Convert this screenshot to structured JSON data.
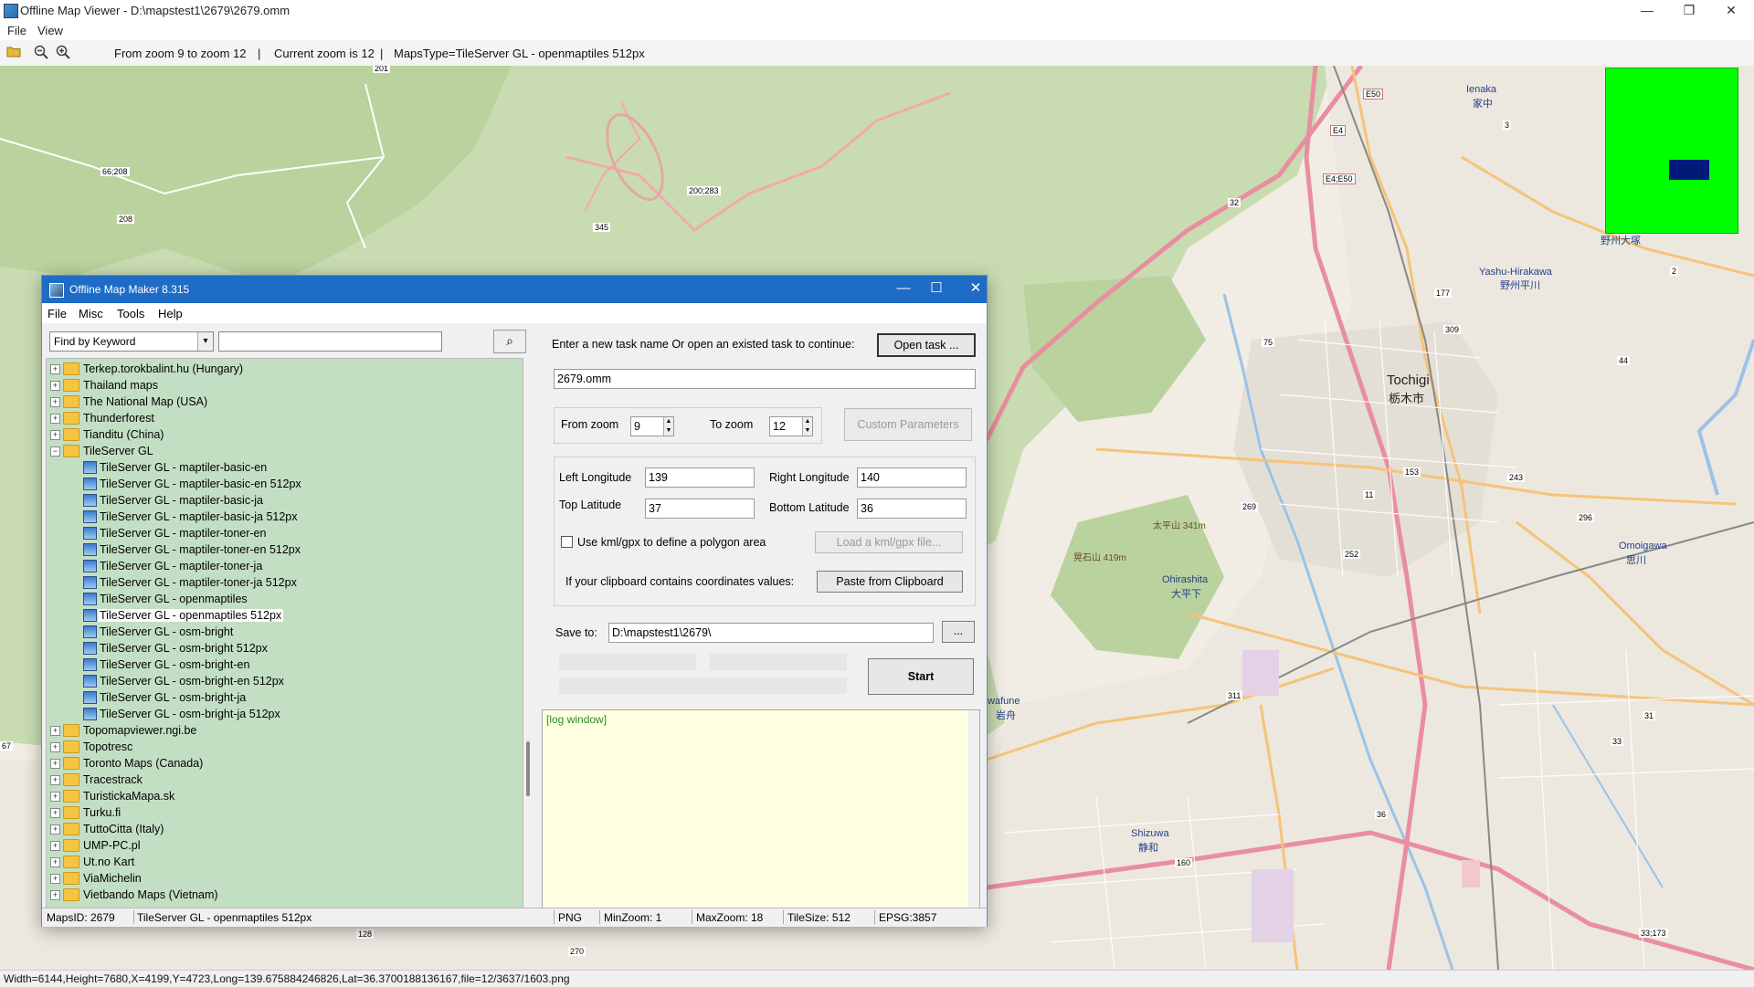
{
  "window": {
    "title": "Offline Map Viewer - D:\\mapstest1\\2679\\2679.omm",
    "minimize": "—",
    "maximize": "❐",
    "close": "✕"
  },
  "menu": {
    "file": "File",
    "view": "View"
  },
  "toolbar": {
    "zoom_range": "From zoom 9 to zoom 12",
    "current_zoom": "Current zoom is 12",
    "maps_type": "MapsType=TileServer GL - openmaptiles 512px",
    "sep": "|"
  },
  "map_labels": [
    {
      "text": "Ienaka"
    },
    {
      "text": "家中"
    },
    {
      "text": "E50"
    },
    {
      "text": "E4"
    },
    {
      "text": "E4;E50"
    },
    {
      "text": "Tochigi"
    },
    {
      "text": "栃木市"
    },
    {
      "text": "Yashu-Hirakawa"
    },
    {
      "text": "野州平川"
    },
    {
      "text": "Ohirashita"
    },
    {
      "text": "大平下"
    },
    {
      "text": "Omoigawa"
    },
    {
      "text": "思川"
    },
    {
      "text": "Iwafune"
    },
    {
      "text": "岩舟"
    },
    {
      "text": "Shizuwa"
    },
    {
      "text": "静和"
    },
    {
      "text": "野州大塚"
    },
    {
      "text": "太平山 341m"
    },
    {
      "text": "晃石山 419m"
    },
    {
      "text": "201"
    },
    {
      "text": "66;208"
    },
    {
      "text": "208"
    },
    {
      "text": "200;283"
    },
    {
      "text": "345"
    },
    {
      "text": "32"
    },
    {
      "text": "309"
    },
    {
      "text": "177"
    },
    {
      "text": "75"
    },
    {
      "text": "44"
    },
    {
      "text": "153"
    },
    {
      "text": "243"
    },
    {
      "text": "269"
    },
    {
      "text": "252"
    },
    {
      "text": "296"
    },
    {
      "text": "311"
    },
    {
      "text": "11"
    },
    {
      "text": "36"
    },
    {
      "text": "33"
    },
    {
      "text": "31"
    },
    {
      "text": "160"
    },
    {
      "text": "128"
    },
    {
      "text": "270"
    },
    {
      "text": "33;173"
    },
    {
      "text": "3"
    },
    {
      "text": "2"
    },
    {
      "text": "67"
    }
  ],
  "statusbar": {
    "text": "Width=6144,Height=7680,X=4199,Y=4723,Long=139.675884246826,Lat=36.3700188136167,file=12/3637/1603.png"
  },
  "dialog": {
    "title": "Offline Map Maker 8.315",
    "minimize": "—",
    "maximize": "☐",
    "close": "✕",
    "menu": [
      "File",
      "Misc",
      "Tools",
      "Help"
    ],
    "find_select": "Find by Keyword",
    "find_arrow": "▾",
    "search_icon": "⌕",
    "tree": [
      {
        "label": "Terkep.torokbalint.hu (Hungary)",
        "type": "folder",
        "exp": "+"
      },
      {
        "label": "Thailand maps",
        "type": "folder",
        "exp": "+"
      },
      {
        "label": "The National Map (USA)",
        "type": "folder",
        "exp": "+"
      },
      {
        "label": "Thunderforest",
        "type": "folder",
        "exp": "+"
      },
      {
        "label": "Tianditu (China)",
        "type": "folder",
        "exp": "+"
      },
      {
        "label": "TileServer GL",
        "type": "folder",
        "exp": "−"
      },
      {
        "label": "TileServer GL - maptiler-basic-en",
        "type": "map"
      },
      {
        "label": "TileServer GL - maptiler-basic-en 512px",
        "type": "map"
      },
      {
        "label": "TileServer GL - maptiler-basic-ja",
        "type": "map"
      },
      {
        "label": "TileServer GL - maptiler-basic-ja 512px",
        "type": "map"
      },
      {
        "label": "TileServer GL - maptiler-toner-en",
        "type": "map"
      },
      {
        "label": "TileServer GL - maptiler-toner-en 512px",
        "type": "map"
      },
      {
        "label": "TileServer GL - maptiler-toner-ja",
        "type": "map"
      },
      {
        "label": "TileServer GL - maptiler-toner-ja 512px",
        "type": "map"
      },
      {
        "label": "TileServer GL - openmaptiles",
        "type": "map"
      },
      {
        "label": "TileServer GL - openmaptiles 512px",
        "type": "map",
        "selected": true
      },
      {
        "label": "TileServer GL - osm-bright",
        "type": "map"
      },
      {
        "label": "TileServer GL - osm-bright 512px",
        "type": "map"
      },
      {
        "label": "TileServer GL - osm-bright-en",
        "type": "map"
      },
      {
        "label": "TileServer GL - osm-bright-en 512px",
        "type": "map"
      },
      {
        "label": "TileServer GL - osm-bright-ja",
        "type": "map"
      },
      {
        "label": "TileServer GL - osm-bright-ja 512px",
        "type": "map"
      },
      {
        "label": "Topomapviewer.ngi.be",
        "type": "folder",
        "exp": "+"
      },
      {
        "label": "Topotresc",
        "type": "folder",
        "exp": "+"
      },
      {
        "label": "Toronto Maps (Canada)",
        "type": "folder",
        "exp": "+"
      },
      {
        "label": "Tracestrack",
        "type": "folder",
        "exp": "+"
      },
      {
        "label": "TuristickaMapa.sk",
        "type": "folder",
        "exp": "+"
      },
      {
        "label": "Turku.fi",
        "type": "folder",
        "exp": "+"
      },
      {
        "label": "TuttoCitta (Italy)",
        "type": "folder",
        "exp": "+"
      },
      {
        "label": "UMP-PC.pl",
        "type": "folder",
        "exp": "+"
      },
      {
        "label": "Ut.no Kart",
        "type": "folder",
        "exp": "+"
      },
      {
        "label": "ViaMichelin",
        "type": "folder",
        "exp": "+"
      },
      {
        "label": "Vietbando Maps (Vietnam)",
        "type": "folder",
        "exp": "+"
      }
    ],
    "task_prompt": "Enter a new task name Or open an existed task to continue:",
    "open_task": "Open task ...",
    "task_name": "2679.omm",
    "from_zoom_label": "From zoom",
    "from_zoom": "9",
    "to_zoom_label": "To zoom",
    "to_zoom": "12",
    "custom_params": "Custom Parameters",
    "left_lon_label": "Left Longitude",
    "left_lon": "139",
    "right_lon_label": "Right Longitude",
    "right_lon": "140",
    "top_lat_label": "Top Latitude",
    "top_lat": "37",
    "bottom_lat_label": "Bottom Latitude",
    "bottom_lat": "36",
    "kml_label": "Use kml/gpx to define a polygon area",
    "load_kml": "Load a kml/gpx file...",
    "clipboard_label": "If your clipboard contains coordinates values:",
    "paste_clipboard": "Paste from Clipboard",
    "save_to_label": "Save to:",
    "save_to": "D:\\mapstest1\\2679\\",
    "browse": "...",
    "start": "Start",
    "log": "[log window]",
    "status": {
      "maps_id": "MapsID: 2679",
      "map_name": "TileServer GL - openmaptiles 512px",
      "format": "PNG",
      "min_zoom": "MinZoom: 1",
      "max_zoom": "MaxZoom: 18",
      "tile_size": "TileSize: 512",
      "epsg": "EPSG:3857"
    }
  }
}
